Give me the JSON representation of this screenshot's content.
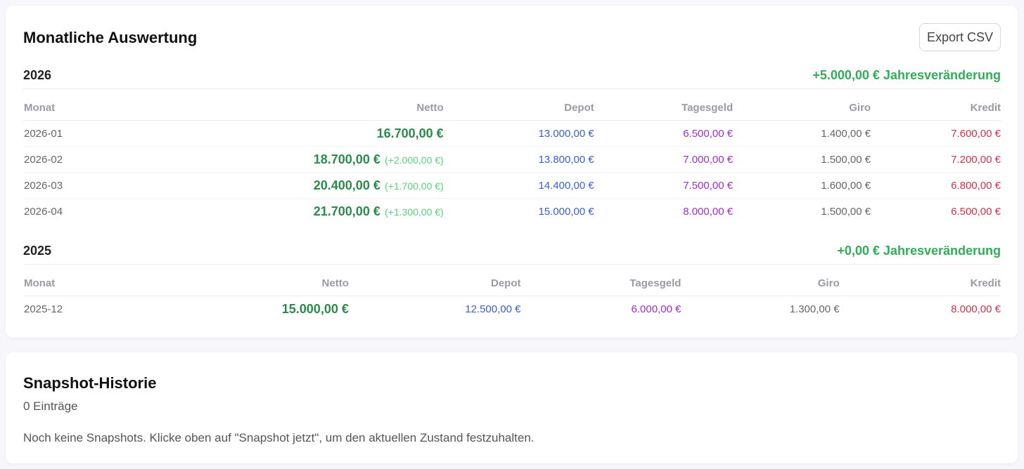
{
  "monthly": {
    "title": "Monatliche Auswertung",
    "export_label": "Export CSV",
    "columns": [
      "Monat",
      "Netto",
      "Depot",
      "Tagesgeld",
      "Giro",
      "Kredit"
    ],
    "years": [
      {
        "year": "2026",
        "change": "+5.000,00 € Jahresveränderung",
        "rows": [
          {
            "month": "2026-01",
            "netto": "16.700,00 €",
            "delta": "",
            "depot": "13.000,00 €",
            "tagesgeld": "6.500,00 €",
            "giro": "1.400,00 €",
            "kredit": "7.600,00 €"
          },
          {
            "month": "2026-02",
            "netto": "18.700,00 €",
            "delta": "(+2.000,00 €)",
            "depot": "13.800,00 €",
            "tagesgeld": "7.000,00 €",
            "giro": "1.500,00 €",
            "kredit": "7.200,00 €"
          },
          {
            "month": "2026-03",
            "netto": "20.400,00 €",
            "delta": "(+1.700,00 €)",
            "depot": "14.400,00 €",
            "tagesgeld": "7.500,00 €",
            "giro": "1.600,00 €",
            "kredit": "6.800,00 €"
          },
          {
            "month": "2026-04",
            "netto": "21.700,00 €",
            "delta": "(+1.300,00 €)",
            "depot": "15.000,00 €",
            "tagesgeld": "8.000,00 €",
            "giro": "1.500,00 €",
            "kredit": "6.500,00 €"
          }
        ]
      },
      {
        "year": "2025",
        "change": "+0,00 € Jahresveränderung",
        "rows": [
          {
            "month": "2025-12",
            "netto": "15.000,00 €",
            "delta": "",
            "depot": "12.500,00 €",
            "tagesgeld": "6.000,00 €",
            "giro": "1.300,00 €",
            "kredit": "8.000,00 €"
          }
        ]
      }
    ]
  },
  "history": {
    "title": "Snapshot-Historie",
    "count": "0 Einträge",
    "empty": "Noch keine Snapshots. Klicke oben auf \"Snapshot jetzt\", um den aktuellen Zustand festzuhalten."
  },
  "colors": {
    "positive": "#2fae57",
    "netto": "#2c8a4c",
    "depot": "#3a5fcf",
    "tagesgeld": "#9b2fcf",
    "kredit": "#d6314a"
  }
}
